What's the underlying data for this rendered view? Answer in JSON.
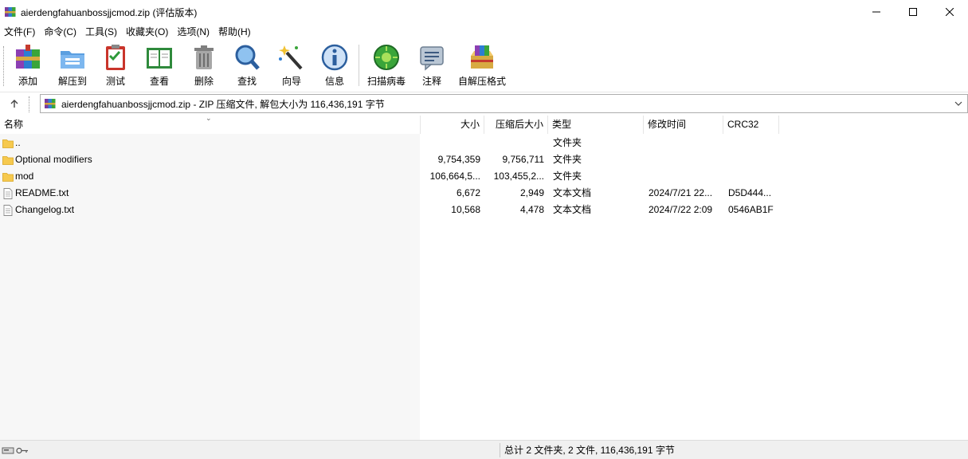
{
  "window": {
    "title": "aierdengfahuanbossjjcmod.zip (评估版本)",
    "controls": {
      "minimize_icon": "minimize-icon",
      "maximize_icon": "maximize-icon",
      "close_icon": "close-icon"
    }
  },
  "menu": [
    "文件(F)",
    "命令(C)",
    "工具(S)",
    "收藏夹(O)",
    "选项(N)",
    "帮助(H)"
  ],
  "toolbar": [
    {
      "label": "添加",
      "icon": "add-archive-icon"
    },
    {
      "label": "解压到",
      "icon": "extract-to-icon"
    },
    {
      "label": "测试",
      "icon": "test-icon"
    },
    {
      "label": "查看",
      "icon": "view-icon"
    },
    {
      "label": "删除",
      "icon": "delete-icon"
    },
    {
      "label": "查找",
      "icon": "find-icon"
    },
    {
      "label": "向导",
      "icon": "wizard-icon"
    },
    {
      "label": "信息",
      "icon": "info-icon"
    },
    {
      "label": "扫描病毒",
      "icon": "virus-scan-icon"
    },
    {
      "label": "注释",
      "icon": "comment-icon"
    },
    {
      "label": "自解压格式",
      "icon": "sfx-icon"
    }
  ],
  "address": {
    "text": "aierdengfahuanbossjjcmod.zip - ZIP 压缩文件, 解包大小为 116,436,191 字节",
    "up_icon": "up-arrow-icon",
    "dropdown_icon": "chevron-down-icon"
  },
  "columns": [
    "名称",
    "大小",
    "压缩后大小",
    "类型",
    "修改时间",
    "CRC32"
  ],
  "rows": [
    {
      "name": "..",
      "size": "",
      "packed": "",
      "type": "文件夹",
      "modified": "",
      "crc": "",
      "icon": "folder-icon"
    },
    {
      "name": "Optional modifiers",
      "size": "9,754,359",
      "packed": "9,756,711",
      "type": "文件夹",
      "modified": "",
      "crc": "",
      "icon": "folder-icon"
    },
    {
      "name": "mod",
      "size": "106,664,5...",
      "packed": "103,455,2...",
      "type": "文件夹",
      "modified": "",
      "crc": "",
      "icon": "folder-icon"
    },
    {
      "name": "README.txt",
      "size": "6,672",
      "packed": "2,949",
      "type": "文本文档",
      "modified": "2024/7/21 22...",
      "crc": "D5D444...",
      "icon": "text-file-icon"
    },
    {
      "name": "Changelog.txt",
      "size": "10,568",
      "packed": "4,478",
      "type": "文本文档",
      "modified": "2024/7/22 2:09",
      "crc": "0546AB1F",
      "icon": "text-file-icon"
    }
  ],
  "status": {
    "text": "总计 2 文件夹, 2 文件, 116,436,191 字节",
    "left_icons": [
      "drive-icon",
      "key-icon"
    ]
  },
  "colors": {
    "folder": "#f6c94e",
    "toolbar_separator": "#cfcfcf",
    "name_column_bg": "#f7f7f7",
    "status_bg": "#f0f0f0"
  }
}
